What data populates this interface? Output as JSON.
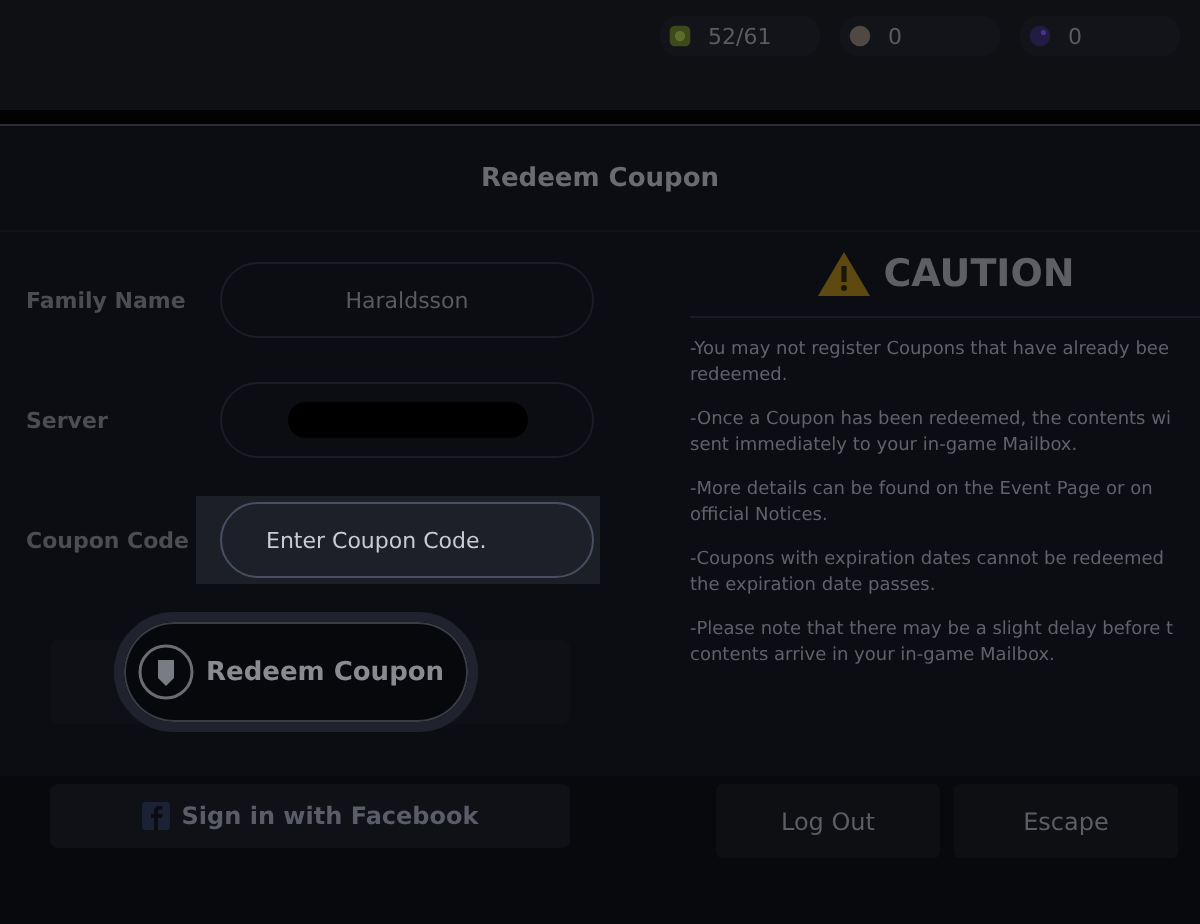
{
  "top_bar": {
    "counters": [
      {
        "kind": "energy",
        "value": "52/61"
      },
      {
        "kind": "coin",
        "value": "0"
      },
      {
        "kind": "gem",
        "value": "0"
      }
    ]
  },
  "dialog": {
    "title": "Redeem Coupon",
    "fields": [
      {
        "kind": "text",
        "label": "Family Name",
        "value": "Haraldsson",
        "highlighted": false
      },
      {
        "kind": "redacted",
        "label": "Server",
        "highlighted": false
      },
      {
        "kind": "input",
        "label": "Coupon Code",
        "placeholder": "Enter Coupon Code.",
        "highlighted": true
      }
    ],
    "redeem_button": "Redeem Coupon",
    "caution": {
      "title": "CAUTION",
      "notes": [
        {
          "lines": [
            "-You may not register Coupons that have already bee",
            "redeemed."
          ]
        },
        {
          "lines": [
            "-Once a Coupon has been redeemed, the contents wi",
            "sent immediately to your in-game Mailbox."
          ]
        },
        {
          "lines": [
            "-More details can be found on the Event Page or on",
            "official Notices."
          ]
        },
        {
          "lines": [
            "-Coupons with expiration dates cannot be redeemed",
            "the expiration date passes."
          ]
        },
        {
          "lines": [
            "-Please note that there may be a slight delay before t",
            "contents arrive in your in-game Mailbox."
          ]
        }
      ]
    }
  },
  "background": {
    "facebook_button": "Sign in with Facebook",
    "buttons": [
      "Log Out",
      "Escape"
    ]
  }
}
